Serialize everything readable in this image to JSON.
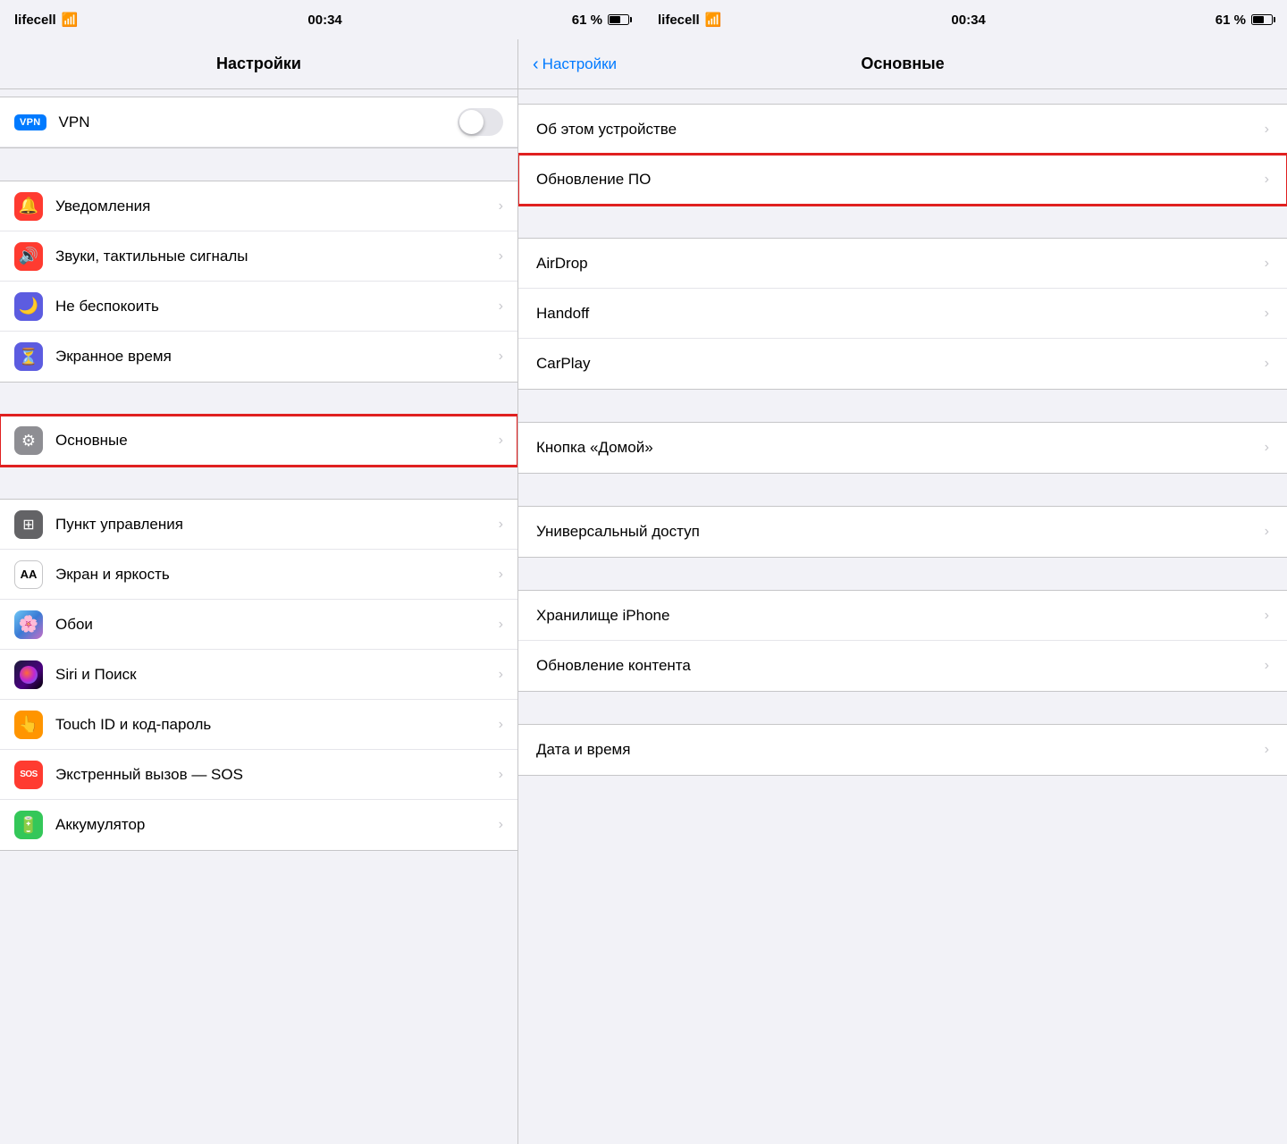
{
  "app": {
    "left_title": "Настройки",
    "right_title": "Основные",
    "back_label": "Настройки"
  },
  "status_bar": {
    "carrier": "lifecell",
    "time": "00:34",
    "battery_pct": "61 %",
    "signal_bars": "▌▌▌",
    "wifi": "wifi"
  },
  "left_panel": {
    "vpn": {
      "label": "VPN",
      "badge": "VPN"
    },
    "sections": [
      {
        "id": "notifications-section",
        "items": [
          {
            "id": "notifications",
            "label": "Уведомления",
            "icon_color": "icon-red",
            "icon_char": "🔔"
          },
          {
            "id": "sounds",
            "label": "Звуки, тактильные сигналы",
            "icon_color": "icon-red",
            "icon_char": "🔊"
          },
          {
            "id": "dnd",
            "label": "Не беспокоить",
            "icon_color": "icon-indigo",
            "icon_char": "🌙"
          },
          {
            "id": "screen-time",
            "label": "Экранное время",
            "icon_color": "icon-indigo",
            "icon_char": "⏳"
          }
        ]
      },
      {
        "id": "general-section",
        "items": [
          {
            "id": "general",
            "label": "Основные",
            "icon_color": "icon-gray",
            "icon_char": "⚙",
            "highlighted": true
          }
        ]
      },
      {
        "id": "display-section",
        "items": [
          {
            "id": "control-center",
            "label": "Пункт управления",
            "icon_color": "icon-gray2",
            "icon_char": "⊞"
          },
          {
            "id": "display",
            "label": "Экран и яркость",
            "icon_color": "icon-dark-gray",
            "icon_char": "AA"
          },
          {
            "id": "wallpaper",
            "label": "Обои",
            "icon_color": "icon-wallpaper",
            "icon_char": "🌸"
          },
          {
            "id": "siri",
            "label": "Siri и Поиск",
            "icon_color": "icon-siri",
            "icon_char": ""
          },
          {
            "id": "touchid",
            "label": "Touch ID и код-пароль",
            "icon_color": "icon-fingerprint",
            "icon_char": "👆"
          },
          {
            "id": "sos",
            "label": "Экстренный вызов — SOS",
            "icon_color": "icon-red",
            "icon_char": "SOS"
          },
          {
            "id": "battery",
            "label": "Аккумулятор",
            "icon_color": "icon-green",
            "icon_char": "🔋"
          }
        ]
      }
    ]
  },
  "right_panel": {
    "top_item": {
      "id": "about",
      "label": "Об этом устройстве"
    },
    "software_update": {
      "id": "software-update",
      "label": "Обновление ПО",
      "highlighted": true
    },
    "section2": [
      {
        "id": "airdrop",
        "label": "AirDrop"
      },
      {
        "id": "handoff",
        "label": "Handoff"
      },
      {
        "id": "carplay",
        "label": "CarPlay"
      }
    ],
    "section3": [
      {
        "id": "home-button",
        "label": "Кнопка «Домой»"
      }
    ],
    "section4": [
      {
        "id": "accessibility",
        "label": "Универсальный доступ"
      }
    ],
    "section5": [
      {
        "id": "storage",
        "label": "Хранилище iPhone"
      },
      {
        "id": "background-refresh",
        "label": "Обновление контента"
      }
    ],
    "section6": [
      {
        "id": "date-time",
        "label": "Дата и время"
      }
    ]
  },
  "chevron": "›"
}
